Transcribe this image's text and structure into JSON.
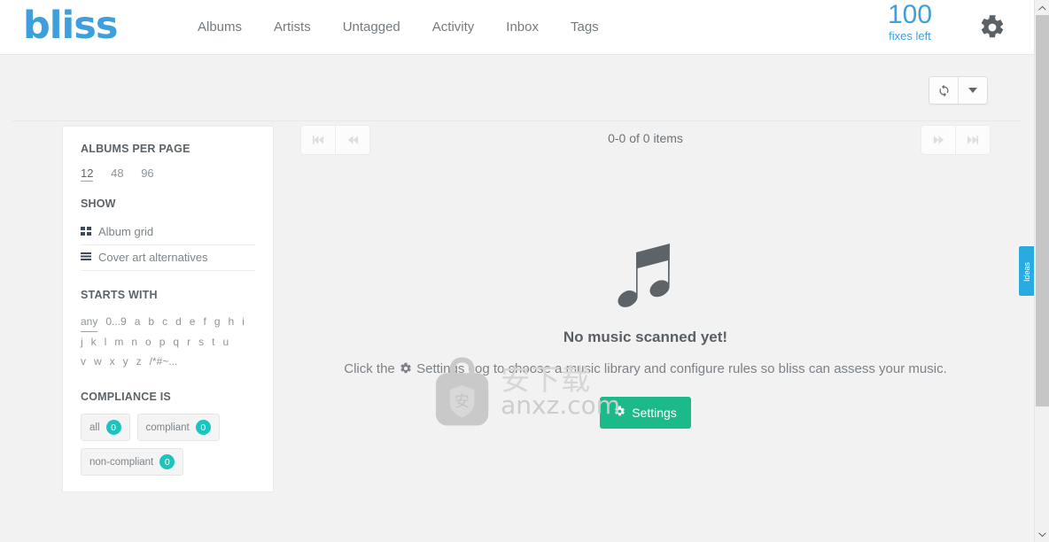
{
  "header": {
    "logo": "bliss",
    "nav": [
      {
        "label": "Albums",
        "name": "nav-albums"
      },
      {
        "label": "Artists",
        "name": "nav-artists"
      },
      {
        "label": "Untagged",
        "name": "nav-untagged"
      },
      {
        "label": "Activity",
        "name": "nav-activity"
      },
      {
        "label": "Inbox",
        "name": "nav-inbox"
      },
      {
        "label": "Tags",
        "name": "nav-tags"
      }
    ],
    "fixes_count": "100",
    "fixes_label": "fixes left",
    "settings_icon": "gear-icon",
    "accent_color": "#3e9fdc"
  },
  "toolbar": {
    "refresh_icon": "refresh-icon",
    "dropdown_icon": "caret-down-icon"
  },
  "sidebar": {
    "albums_per_page": {
      "title": "ALBUMS PER PAGE",
      "options": [
        "12",
        "48",
        "96"
      ],
      "selected": "12"
    },
    "show": {
      "title": "SHOW",
      "items": [
        {
          "label": "Album grid",
          "icon": "grid-icon"
        },
        {
          "label": "Cover art alternatives",
          "icon": "list-icon"
        }
      ]
    },
    "starts_with": {
      "title": "STARTS WITH",
      "selected": "any",
      "rows": [
        [
          "any",
          "0...9",
          "a",
          "b",
          "c",
          "d",
          "e",
          "f",
          "g",
          "h",
          "i"
        ],
        [
          "j",
          "k",
          "l",
          "m",
          "n",
          "o",
          "p",
          "q",
          "r",
          "s",
          "t",
          "u"
        ],
        [
          "v",
          "w",
          "x",
          "y",
          "z",
          "/*#~..."
        ]
      ]
    },
    "compliance": {
      "title": "COMPLIANCE IS",
      "badge_color": "#1dc3be",
      "items": [
        {
          "label": "all",
          "count": "0"
        },
        {
          "label": "compliant",
          "count": "0"
        },
        {
          "label": "non-compliant",
          "count": "0"
        }
      ]
    }
  },
  "main": {
    "pagination": {
      "count_text": "0-0 of 0 items",
      "first_icon": "skip-to-first-icon",
      "prev_icon": "previous-page-icon",
      "next_icon": "next-page-icon",
      "last_icon": "skip-to-last-icon"
    },
    "empty_state": {
      "icon": "music-note-icon",
      "title": "No music scanned yet!",
      "description_before": "Click the",
      "description_after": "Settings cog to choose a music library and configure rules so bliss can assess your music.",
      "button_label": "Settings",
      "button_icon": "gear-icon",
      "button_color": "#1cb98a"
    }
  },
  "watermark": {
    "cn_text": "安下载",
    "url_text": "anxz.com",
    "icon": "bag-shield-icon"
  },
  "feedback_tab": {
    "label": "Ideas",
    "color": "#29abe2"
  },
  "scrollbar": {
    "up_icon": "chevron-up-icon",
    "down_icon": "chevron-down-icon"
  }
}
